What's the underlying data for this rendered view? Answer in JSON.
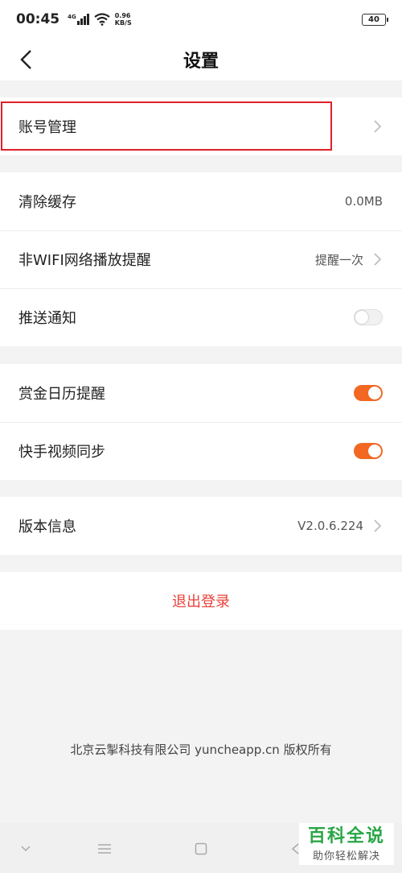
{
  "status_bar": {
    "time": "00:45",
    "network": "4G",
    "speed_value": "0.96",
    "speed_unit": "KB/S",
    "battery": "40"
  },
  "nav": {
    "title": "设置"
  },
  "groups": {
    "account": {
      "label": "账号管理"
    },
    "cache": {
      "label": "清除缓存",
      "value": "0.0MB"
    },
    "wifi_reminder": {
      "label": "非WIFI网络播放提醒",
      "value": "提醒一次"
    },
    "push": {
      "label": "推送通知",
      "enabled": false
    },
    "bounty_calendar": {
      "label": "赏金日历提醒",
      "enabled": true
    },
    "kuaishou_sync": {
      "label": "快手视频同步",
      "enabled": true
    },
    "version": {
      "label": "版本信息",
      "value": "V2.0.6.224"
    },
    "logout": {
      "label": "退出登录"
    }
  },
  "footer": {
    "copyright": "北京云掣科技有限公司 yuncheapp.cn 版权所有"
  },
  "watermark": {
    "main": "百科全说",
    "sub": "助你轻松解决"
  },
  "colors": {
    "accent": "#f26722",
    "logout": "#e8413a",
    "highlight": "#e0202a"
  }
}
